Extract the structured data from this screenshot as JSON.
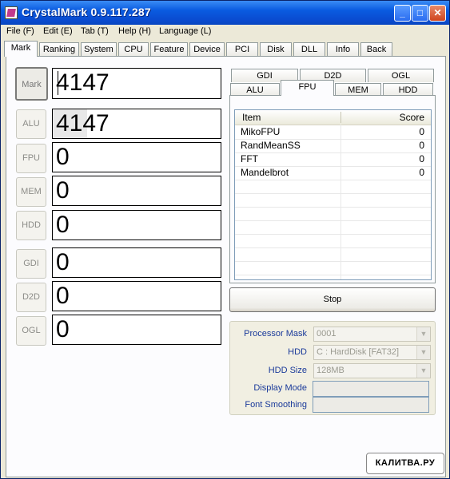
{
  "window": {
    "title": "CrystalMark 0.9.117.287",
    "controls": {
      "minimize": "_",
      "maximize": "□",
      "close": "✕"
    }
  },
  "menu": [
    "File (F)",
    "Edit (E)",
    "Tab (T)",
    "Help (H)",
    "Language (L)"
  ],
  "top_tabs": [
    "Mark",
    "Ranking",
    "System",
    "CPU",
    "Feature",
    "Device",
    "PCI",
    "Disk",
    "DLL",
    "Info",
    "Back"
  ],
  "active_top_tab": "Mark",
  "score_buttons": [
    {
      "label": "Mark",
      "score": "4147"
    },
    {
      "label": "ALU",
      "score": "4147"
    },
    {
      "label": "FPU",
      "score": "0"
    },
    {
      "label": "MEM",
      "score": "0"
    },
    {
      "label": "HDD",
      "score": "0"
    },
    {
      "label": "GDI",
      "score": "0"
    },
    {
      "label": "D2D",
      "score": "0"
    },
    {
      "label": "OGL",
      "score": "0"
    }
  ],
  "result_tabs_row1": [
    "GDI",
    "D2D",
    "OGL"
  ],
  "result_tabs_row2": [
    "ALU",
    "FPU",
    "MEM",
    "HDD"
  ],
  "active_result_tab": "FPU",
  "list": {
    "headers": {
      "item": "Item",
      "score": "Score"
    },
    "rows": [
      {
        "item": "MikoFPU",
        "score": "0"
      },
      {
        "item": "RandMeanSS",
        "score": "0"
      },
      {
        "item": "FFT",
        "score": "0"
      },
      {
        "item": "Mandelbrot",
        "score": "0"
      }
    ]
  },
  "stop_button": "Stop",
  "settings": {
    "processor_mask": {
      "label": "Processor Mask",
      "value": "0001"
    },
    "hdd": {
      "label": "HDD",
      "value": "C : HardDisk [FAT32]"
    },
    "hdd_size": {
      "label": "HDD Size",
      "value": "128MB"
    },
    "display_mode": {
      "label": "Display Mode",
      "value": ""
    },
    "font_smoothing": {
      "label": "Font Smoothing",
      "value": ""
    }
  },
  "watermark": "КАЛИТВА.РУ"
}
